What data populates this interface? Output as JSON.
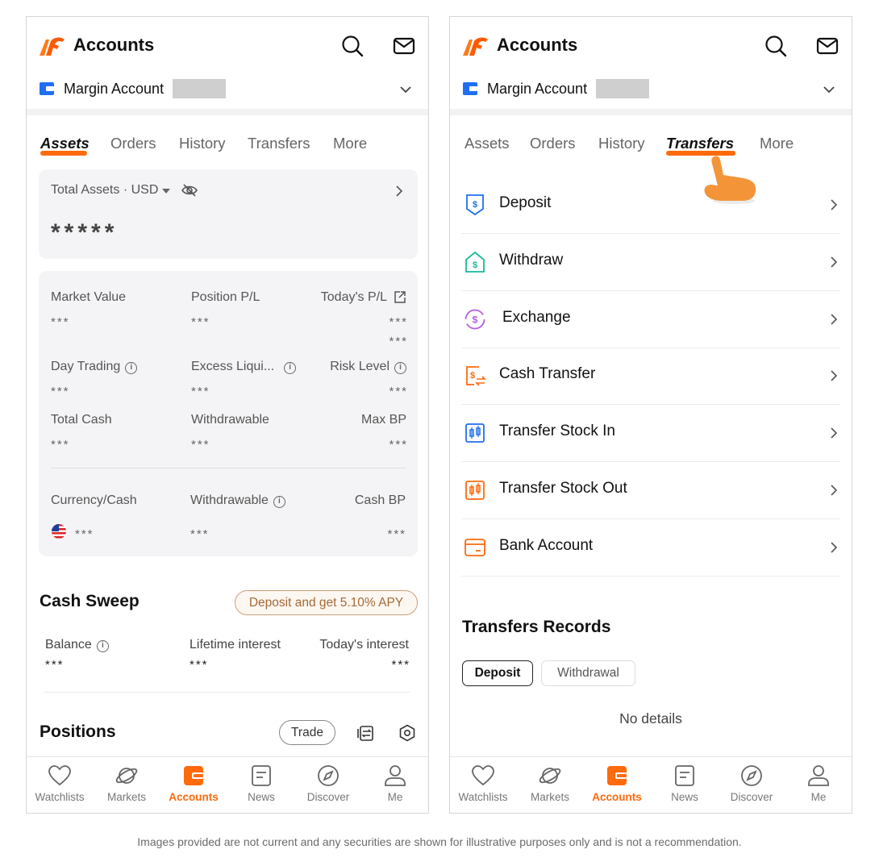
{
  "header": {
    "title": "Accounts"
  },
  "account": {
    "name": "Margin Account"
  },
  "tabs": [
    "Assets",
    "Orders",
    "History",
    "Transfers",
    "More"
  ],
  "assets": {
    "total_label": "Total Assets · USD",
    "total_value": "*****",
    "metrics": {
      "market_value": {
        "label": "Market Value",
        "value": "***"
      },
      "position_pl": {
        "label": "Position P/L",
        "value": "***"
      },
      "todays_pl": {
        "label": "Today's P/L",
        "value": "***",
        "value2": "***"
      },
      "day_trading": {
        "label": "Day Trading",
        "value": "***"
      },
      "excess_liquidity": {
        "label": "Excess Liqui...",
        "value": "***"
      },
      "risk_level": {
        "label": "Risk Level",
        "value": "***"
      },
      "total_cash": {
        "label": "Total Cash",
        "value": "***"
      },
      "withdrawable": {
        "label": "Withdrawable",
        "value": "***"
      },
      "max_bp": {
        "label": "Max BP",
        "value": "***"
      }
    },
    "currency": {
      "col1": "Currency/Cash",
      "col2": "Withdrawable",
      "col3": "Cash BP",
      "row": {
        "cash": "***",
        "withdrawable": "***",
        "cash_bp": "***"
      }
    }
  },
  "cash_sweep": {
    "title": "Cash Sweep",
    "promo": "Deposit and get 5.10% APY",
    "balance_label": "Balance",
    "lifetime_label": "Lifetime interest",
    "today_label": "Today's interest",
    "balance": "***",
    "lifetime": "***",
    "today": "***"
  },
  "positions": {
    "title": "Positions",
    "trade_button": "Trade"
  },
  "transfers": {
    "items": [
      {
        "label": "Deposit",
        "icon": "deposit-icon"
      },
      {
        "label": "Withdraw",
        "icon": "withdraw-icon"
      },
      {
        "label": "Exchange",
        "icon": "exchange-icon"
      },
      {
        "label": "Cash Transfer",
        "icon": "cash-transfer-icon"
      },
      {
        "label": "Transfer Stock In",
        "icon": "transfer-stock-in-icon"
      },
      {
        "label": "Transfer Stock Out",
        "icon": "transfer-stock-out-icon"
      },
      {
        "label": "Bank Account",
        "icon": "bank-account-icon"
      }
    ],
    "records_title": "Transfers Records",
    "filters": [
      "Deposit",
      "Withdrawal"
    ],
    "empty_text": "No details"
  },
  "bottom_nav": [
    {
      "label": "Watchlists",
      "icon": "heart-icon"
    },
    {
      "label": "Markets",
      "icon": "planet-icon"
    },
    {
      "label": "Accounts",
      "icon": "wallet-icon"
    },
    {
      "label": "News",
      "icon": "news-icon"
    },
    {
      "label": "Discover",
      "icon": "compass-icon"
    },
    {
      "label": "Me",
      "icon": "person-icon"
    }
  ],
  "colors": {
    "accent": "#ff6a0d",
    "blue": "#1f6ff2",
    "teal": "#17b89c",
    "purple": "#b65ce0",
    "sweep_border": "#c8a07a"
  },
  "footer_note": "Images provided are not current and any securities are shown for illustrative purposes only and is not a recommendation."
}
